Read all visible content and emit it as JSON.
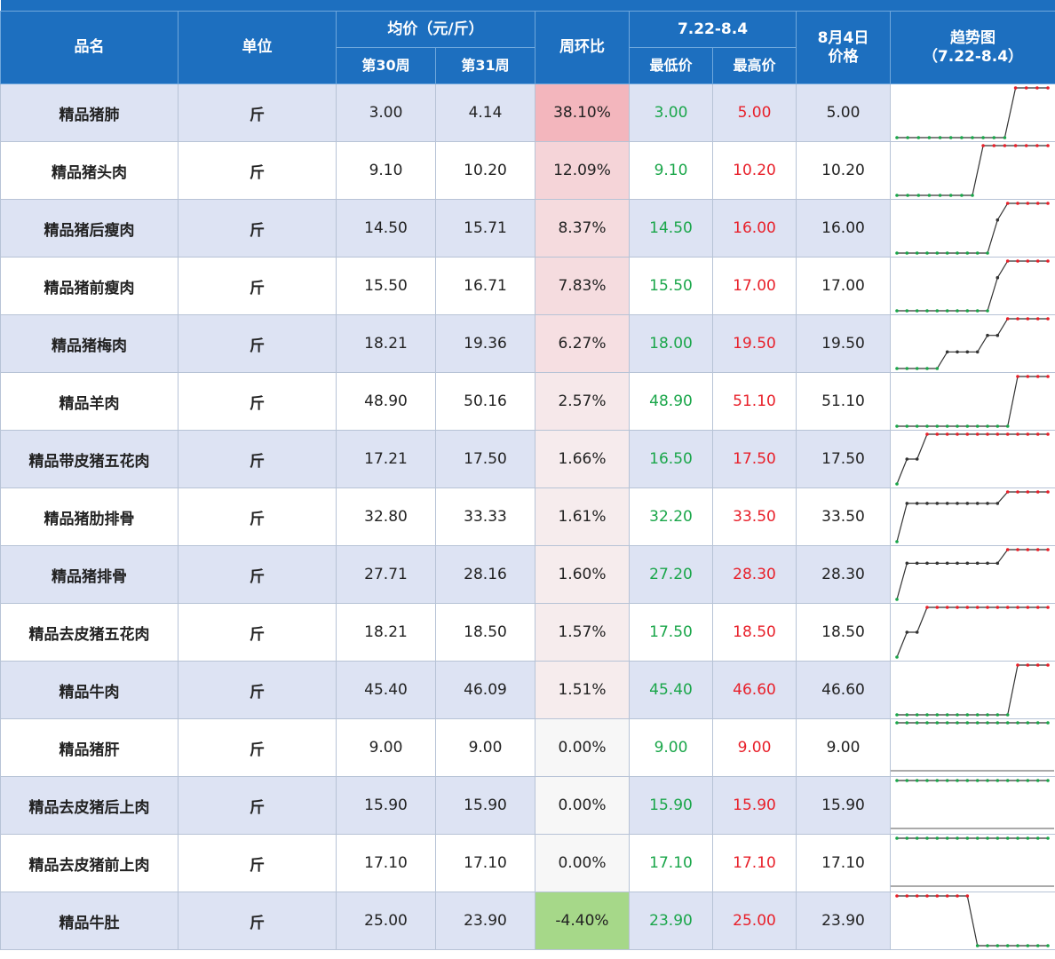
{
  "header": {
    "name": "品名",
    "unit": "单位",
    "avg_price": "均价（元/斤）",
    "week30": "第30周",
    "week31": "第31周",
    "wow": "周环比",
    "period": "7.22-8.4",
    "min_price": "最低价",
    "max_price": "最高价",
    "aug4_line1": "8月4日",
    "aug4_line2": "价格",
    "trend_line1": "趋势图",
    "trend_line2": "（7.22-8.4）"
  },
  "colors": {
    "header_bg": "#1d6fbf",
    "row_alt_bg": "#dde3f3",
    "min_text": "#1aa64a",
    "max_text": "#e8202a",
    "wow_positive": "#f3b6bd",
    "wow_zero": "#f7f7f7",
    "wow_negative": "#a6d889"
  },
  "rows": [
    {
      "name": "精品猪肺",
      "unit": "斤",
      "w30": "3.00",
      "w31": "4.14",
      "wow": "38.10%",
      "wow_value": 38.1,
      "min": "3.00",
      "max": "5.00",
      "price": "5.00",
      "trend": [
        3,
        3,
        3,
        3,
        3,
        3,
        3,
        3,
        3,
        3,
        3,
        5,
        5,
        5,
        5
      ]
    },
    {
      "name": "精品猪头肉",
      "unit": "斤",
      "w30": "9.10",
      "w31": "10.20",
      "wow": "12.09%",
      "wow_value": 12.09,
      "min": "9.10",
      "max": "10.20",
      "price": "10.20",
      "trend": [
        9.1,
        9.1,
        9.1,
        9.1,
        9.1,
        9.1,
        9.1,
        9.1,
        10.2,
        10.2,
        10.2,
        10.2,
        10.2,
        10.2,
        10.2
      ]
    },
    {
      "name": "精品猪后瘦肉",
      "unit": "斤",
      "w30": "14.50",
      "w31": "15.71",
      "wow": "8.37%",
      "wow_value": 8.37,
      "min": "14.50",
      "max": "16.00",
      "price": "16.00",
      "trend": [
        14.5,
        14.5,
        14.5,
        14.5,
        14.5,
        14.5,
        14.5,
        14.5,
        14.5,
        14.5,
        15.5,
        16,
        16,
        16,
        16,
        16
      ]
    },
    {
      "name": "精品猪前瘦肉",
      "unit": "斤",
      "w30": "15.50",
      "w31": "16.71",
      "wow": "7.83%",
      "wow_value": 7.83,
      "min": "15.50",
      "max": "17.00",
      "price": "17.00",
      "trend": [
        15.5,
        15.5,
        15.5,
        15.5,
        15.5,
        15.5,
        15.5,
        15.5,
        15.5,
        15.5,
        16.5,
        17,
        17,
        17,
        17,
        17
      ]
    },
    {
      "name": "精品猪梅肉",
      "unit": "斤",
      "w30": "18.21",
      "w31": "19.36",
      "wow": "6.27%",
      "wow_value": 6.27,
      "min": "18.00",
      "max": "19.50",
      "price": "19.50",
      "trend": [
        18,
        18,
        18,
        18,
        18,
        18.5,
        18.5,
        18.5,
        18.5,
        19,
        19,
        19.5,
        19.5,
        19.5,
        19.5,
        19.5
      ]
    },
    {
      "name": "精品羊肉",
      "unit": "斤",
      "w30": "48.90",
      "w31": "50.16",
      "wow": "2.57%",
      "wow_value": 2.57,
      "min": "48.90",
      "max": "51.10",
      "price": "51.10",
      "trend": [
        48.9,
        48.9,
        48.9,
        48.9,
        48.9,
        48.9,
        48.9,
        48.9,
        48.9,
        48.9,
        48.9,
        48.9,
        51.1,
        51.1,
        51.1,
        51.1
      ]
    },
    {
      "name": "精品带皮猪五花肉",
      "unit": "斤",
      "w30": "17.21",
      "w31": "17.50",
      "wow": "1.66%",
      "wow_value": 1.66,
      "min": "16.50",
      "max": "17.50",
      "price": "17.50",
      "trend": [
        16.5,
        17,
        17,
        17.5,
        17.5,
        17.5,
        17.5,
        17.5,
        17.5,
        17.5,
        17.5,
        17.5,
        17.5,
        17.5,
        17.5,
        17.5
      ]
    },
    {
      "name": "精品猪肋排骨",
      "unit": "斤",
      "w30": "32.80",
      "w31": "33.33",
      "wow": "1.61%",
      "wow_value": 1.61,
      "min": "32.20",
      "max": "33.50",
      "price": "33.50",
      "trend": [
        32.2,
        33.2,
        33.2,
        33.2,
        33.2,
        33.2,
        33.2,
        33.2,
        33.2,
        33.2,
        33.2,
        33.5,
        33.5,
        33.5,
        33.5,
        33.5
      ]
    },
    {
      "name": "精品猪排骨",
      "unit": "斤",
      "w30": "27.71",
      "w31": "28.16",
      "wow": "1.60%",
      "wow_value": 1.6,
      "min": "27.20",
      "max": "28.30",
      "price": "28.30",
      "trend": [
        27.2,
        28,
        28,
        28,
        28,
        28,
        28,
        28,
        28,
        28,
        28,
        28.3,
        28.3,
        28.3,
        28.3,
        28.3
      ]
    },
    {
      "name": "精品去皮猪五花肉",
      "unit": "斤",
      "w30": "18.21",
      "w31": "18.50",
      "wow": "1.57%",
      "wow_value": 1.57,
      "min": "17.50",
      "max": "18.50",
      "price": "18.50",
      "trend": [
        17.5,
        18,
        18,
        18.5,
        18.5,
        18.5,
        18.5,
        18.5,
        18.5,
        18.5,
        18.5,
        18.5,
        18.5,
        18.5,
        18.5,
        18.5
      ]
    },
    {
      "name": "精品牛肉",
      "unit": "斤",
      "w30": "45.40",
      "w31": "46.09",
      "wow": "1.51%",
      "wow_value": 1.51,
      "min": "45.40",
      "max": "46.60",
      "price": "46.60",
      "trend": [
        45.4,
        45.4,
        45.4,
        45.4,
        45.4,
        45.4,
        45.4,
        45.4,
        45.4,
        45.4,
        45.4,
        45.4,
        46.6,
        46.6,
        46.6,
        46.6
      ]
    },
    {
      "name": "精品猪肝",
      "unit": "斤",
      "w30": "9.00",
      "w31": "9.00",
      "wow": "0.00%",
      "wow_value": 0.0,
      "min": "9.00",
      "max": "9.00",
      "price": "9.00",
      "trend": [
        9,
        9,
        9,
        9,
        9,
        9,
        9,
        9,
        9,
        9,
        9,
        9,
        9,
        9,
        9,
        9
      ]
    },
    {
      "name": "精品去皮猪后上肉",
      "unit": "斤",
      "w30": "15.90",
      "w31": "15.90",
      "wow": "0.00%",
      "wow_value": 0.0,
      "min": "15.90",
      "max": "15.90",
      "price": "15.90",
      "trend": [
        15.9,
        15.9,
        15.9,
        15.9,
        15.9,
        15.9,
        15.9,
        15.9,
        15.9,
        15.9,
        15.9,
        15.9,
        15.9,
        15.9,
        15.9,
        15.9
      ]
    },
    {
      "name": "精品去皮猪前上肉",
      "unit": "斤",
      "w30": "17.10",
      "w31": "17.10",
      "wow": "0.00%",
      "wow_value": 0.0,
      "min": "17.10",
      "max": "17.10",
      "price": "17.10",
      "trend": [
        17.1,
        17.1,
        17.1,
        17.1,
        17.1,
        17.1,
        17.1,
        17.1,
        17.1,
        17.1,
        17.1,
        17.1,
        17.1,
        17.1,
        17.1,
        17.1
      ]
    },
    {
      "name": "精品牛肚",
      "unit": "斤",
      "w30": "25.00",
      "w31": "23.90",
      "wow": "-4.40%",
      "wow_value": -4.4,
      "min": "23.90",
      "max": "25.00",
      "price": "23.90",
      "trend": [
        25,
        25,
        25,
        25,
        25,
        25,
        25,
        25,
        23.9,
        23.9,
        23.9,
        23.9,
        23.9,
        23.9,
        23.9,
        23.9
      ]
    }
  ]
}
